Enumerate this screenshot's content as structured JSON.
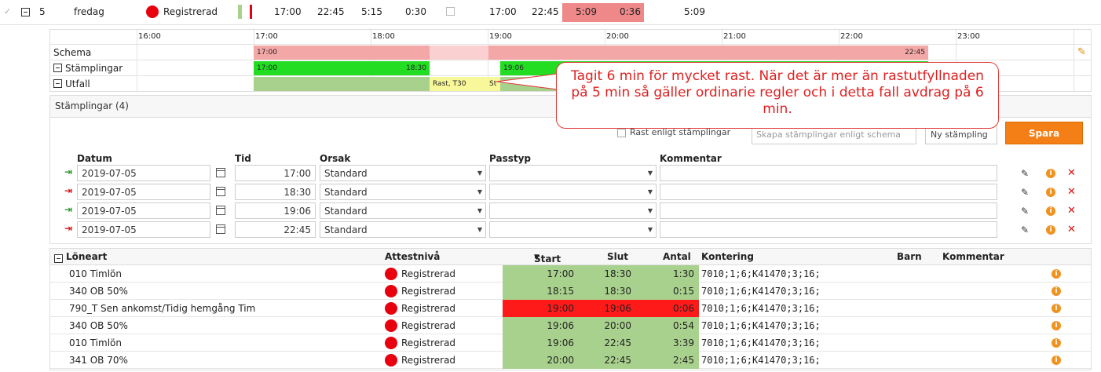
{
  "top_row": {
    "checkmark": "✓",
    "day_number": "5",
    "weekday": "fredag",
    "status": "Registrerad",
    "sched_start": "17:00",
    "sched_end": "22:45",
    "sched_length": "5:15",
    "break_time": "0:30",
    "actual_start": "17:00",
    "actual_end": "22:45",
    "worked": "5:09",
    "diff": "0:36",
    "total": "5:09"
  },
  "timeline": {
    "hours": [
      "16:00",
      "17:00",
      "18:00",
      "19:00",
      "20:00",
      "21:00",
      "22:00",
      "23:00"
    ],
    "rows": {
      "schema_label": "Schema",
      "stamplingar_label": "Stämplingar",
      "utfall_label": "Utfall"
    },
    "schema_bar": {
      "start": "17:00",
      "end": "22:45"
    },
    "stamp_bar1": {
      "start": "17:00",
      "end": "18:30"
    },
    "stamp_bar2": {
      "start": "19:06"
    },
    "utfall_rast": "Rast, T30",
    "utfall_st": "St"
  },
  "tooltip": {
    "text": "Tagit 6 min för mycket rast. När det är mer än rastutfyllnaden på 5 min så gäller ordinarie regler och i detta fall avdrag på 6 min."
  },
  "stamplingar": {
    "title": "Stämplingar (4)",
    "rast_checkbox_label": "Rast enligt stämplingar",
    "skapa_placeholder": "Skapa stämplingar enligt schema",
    "ny_button": "Ny stämpling",
    "spara_button": "Spara",
    "headers": {
      "datum": "Datum",
      "tid": "Tid",
      "orsak": "Orsak",
      "passtyp": "Passtyp",
      "kommentar": "Kommentar"
    },
    "rows": [
      {
        "direction": "in",
        "date": "2019-07-05",
        "time": "17:00",
        "reason": "Standard",
        "passtyp": "",
        "comment": ""
      },
      {
        "direction": "out",
        "date": "2019-07-05",
        "time": "18:30",
        "reason": "Standard",
        "passtyp": "",
        "comment": ""
      },
      {
        "direction": "in",
        "date": "2019-07-05",
        "time": "19:06",
        "reason": "Standard",
        "passtyp": "",
        "comment": ""
      },
      {
        "direction": "out",
        "date": "2019-07-05",
        "time": "22:45",
        "reason": "Standard",
        "passtyp": "",
        "comment": ""
      }
    ]
  },
  "loneart": {
    "headers": {
      "loneart": "Löneart",
      "attestniva": "Attestnivå",
      "start": "Start",
      "slut": "Slut",
      "antal": "Antal",
      "kontering": "Kontering",
      "barn": "Barn",
      "kommentar": "Kommentar"
    },
    "rows": [
      {
        "name": "010 Timlön",
        "status": "Registrerad",
        "start": "17:00",
        "end": "18:30",
        "count": "1:30",
        "kontering": "7010;1;6;K41470;3;16;",
        "highlight": "green"
      },
      {
        "name": "340 OB 50%",
        "status": "Registrerad",
        "start": "18:15",
        "end": "18:30",
        "count": "0:15",
        "kontering": "7010;1;6;K41470;3;16;",
        "highlight": "green"
      },
      {
        "name": "790_T Sen ankomst/Tidig hemgång Tim",
        "status": "Registrerad",
        "start": "19:00",
        "end": "19:06",
        "count": "0:06",
        "kontering": "7010;1;6;K41470;3;16;",
        "highlight": "red"
      },
      {
        "name": "340 OB 50%",
        "status": "Registrerad",
        "start": "19:06",
        "end": "20:00",
        "count": "0:54",
        "kontering": "7010;1;6;K41470;3;16;",
        "highlight": "green"
      },
      {
        "name": "010 Timlön",
        "status": "Registrerad",
        "start": "19:06",
        "end": "22:45",
        "count": "3:39",
        "kontering": "7010;1;6;K41470;3;16;",
        "highlight": "green"
      },
      {
        "name": "341 OB 70%",
        "status": "Registrerad",
        "start": "20:00",
        "end": "22:45",
        "count": "2:45",
        "kontering": "7010;1;6;K41470;3;16;",
        "highlight": "green"
      }
    ]
  },
  "colors": {
    "schema_pink": "#f4a7a7",
    "stamp_green": "#22dd22",
    "utfall_green": "#a9d18e",
    "rast_yellow": "#f8f89a",
    "red_highlight": "#ff1a1a",
    "orange_button": "#f57f17",
    "status_red": "#e8000e"
  }
}
